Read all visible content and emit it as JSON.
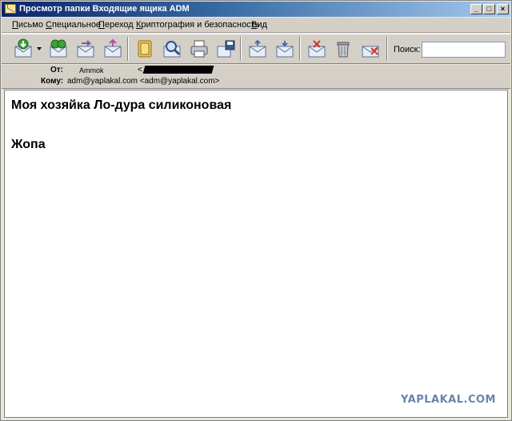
{
  "window": {
    "title": "Просмотр папки Входящие ящика ADM",
    "min_label": "_",
    "max_label": "□",
    "close_label": "×"
  },
  "menu": {
    "items": [
      "Письмо",
      "Специальное",
      "Переход",
      "Криптография и безопасность",
      "Вид"
    ]
  },
  "toolbar": {
    "icons": [
      "receive-mail-icon",
      "dropdown-arrow-icon",
      "reply-all-icon",
      "forward-icon",
      "new-mail-icon",
      "address-book-icon",
      "find-icon",
      "print-icon",
      "save-icon",
      "previous-message-icon",
      "next-message-icon",
      "move-icon",
      "delete-icon",
      "junk-icon"
    ],
    "search_label": "Поиск:",
    "search_value": ""
  },
  "headers": {
    "from_label": "От:",
    "from_name": "Ammok",
    "from_email_prefix": "<",
    "to_label": "Кому:",
    "to_value": "adm@yaplakal.com <adm@yaplakal.com>"
  },
  "message": {
    "line1": "Моя хозяйка Ло-дура силиконовая",
    "line2": "Жопа"
  },
  "watermark": "YAPLAKAL.COM",
  "colors": {
    "titlebar_start": "#0a246a",
    "titlebar_end": "#a6caf0",
    "chrome": "#d4d0c8",
    "watermark": "#4f6f9c"
  }
}
